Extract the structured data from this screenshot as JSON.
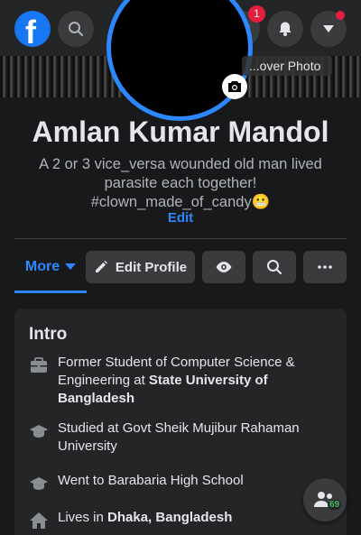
{
  "nav": {
    "messenger_badge": "1"
  },
  "cover": {
    "cover_photo_label": "...over Photo"
  },
  "profile": {
    "name": "Amlan Kumar Mandol",
    "bio_line1": "A 2 or 3 vice_versa wounded old man lived",
    "bio_line2": "parasite each together!",
    "bio_line3": "#clown_made_of_candy",
    "bio_emoji": "😬",
    "edit_label": "Edit"
  },
  "actions": {
    "more_label": "More",
    "edit_profile_label": "Edit Profile"
  },
  "intro": {
    "title": "Intro",
    "items": [
      {
        "icon": "briefcase-icon",
        "text1": "Former Student of Computer Science & Engineering at ",
        "bold": "State University of Bangladesh"
      },
      {
        "icon": "graduation-cap-icon",
        "text1": "Studied at Govt Sheik Mujibur Rahaman University",
        "bold": ""
      },
      {
        "icon": "graduation-cap-icon",
        "text1": "Went to Barabaria High School",
        "bold": ""
      },
      {
        "icon": "home-icon",
        "text1": "Lives in ",
        "bold": "Dhaka, Bangladesh"
      }
    ]
  },
  "fab": {
    "count": "69"
  },
  "colors": {
    "accent": "#2d88ff",
    "background": "#18191a",
    "card": "#242526",
    "button": "#3a3b3c",
    "badge": "#e41e3f"
  }
}
